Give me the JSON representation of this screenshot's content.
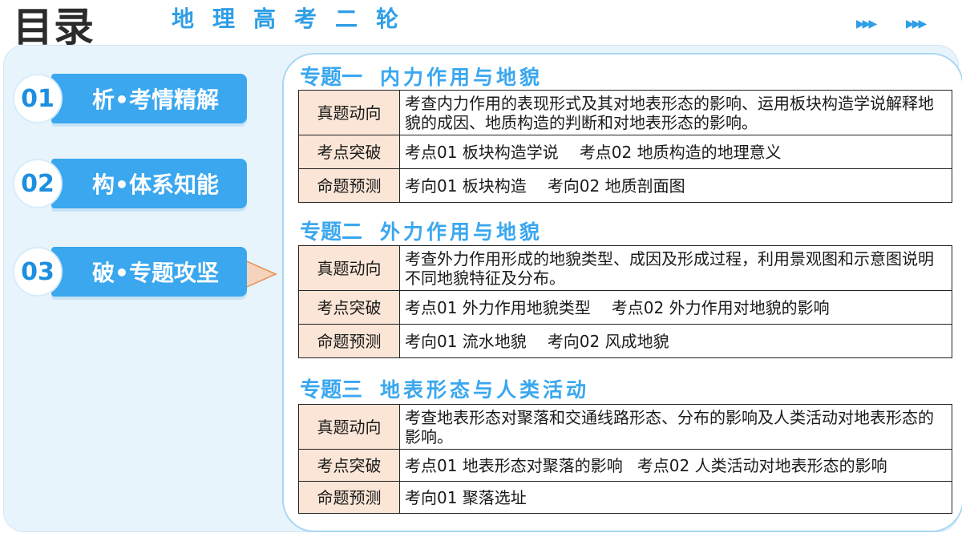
{
  "header": {
    "title": "目录",
    "subtitle": "地理高考二轮"
  },
  "nav": [
    {
      "num": "01",
      "label": "析•考情精解"
    },
    {
      "num": "02",
      "label": "构•体系知能"
    },
    {
      "num": "03",
      "label": "破•专题攻坚"
    }
  ],
  "topics": [
    {
      "num": "专题一",
      "name": "内力作用与地貌",
      "rows": [
        {
          "label": "真题动向",
          "content": "考查内力作用的表现形式及其对地表形态的影响、运用板块构造学说解释地貌的成因、地质构造的判断和对地表形态的影响。"
        },
        {
          "label": "考点突破",
          "items": [
            "考点01 板块构造学说",
            "考点02 地质构造的地理意义"
          ]
        },
        {
          "label": "命题预测",
          "items": [
            "考向01 板块构造",
            "考向02 地质剖面图"
          ]
        }
      ]
    },
    {
      "num": "专题二",
      "name": "外力作用与地貌",
      "rows": [
        {
          "label": "真题动向",
          "content": "考查外力作用形成的地貌类型、成因及形成过程，利用景观图和示意图说明不同地貌特征及分布。"
        },
        {
          "label": "考点突破",
          "items": [
            "考点01 外力作用地貌类型",
            "考点02 外力作用对地貌的影响"
          ]
        },
        {
          "label": "命题预测",
          "items": [
            "考向01 流水地貌",
            "考向02 风成地貌"
          ]
        }
      ]
    },
    {
      "num": "专题三",
      "name": "地表形态与人类活动",
      "rows": [
        {
          "label": "真题动向",
          "content": "考查地表形态对聚落和交通线路形态、分布的影响及人类活动对地表形态的影响。"
        },
        {
          "label": "考点突破",
          "items": [
            "考点01 地表形态对聚落的影响",
            "考点02 人类活动对地表形态的影响"
          ]
        },
        {
          "label": "命题预测",
          "items": [
            "考向01 聚落选址"
          ]
        }
      ]
    }
  ],
  "colors": {
    "accent": "#3aa7ef",
    "label_bg": "#fbe5d6",
    "arrow": "#e7915a"
  }
}
